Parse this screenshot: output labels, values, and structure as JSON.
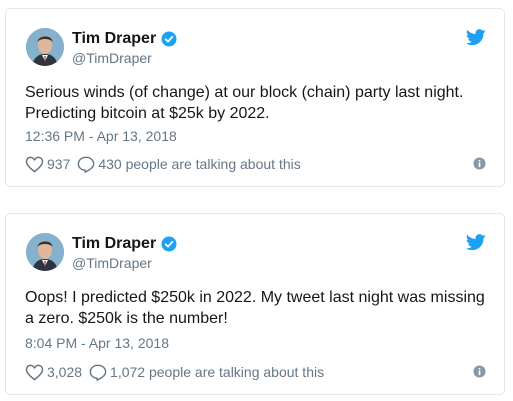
{
  "colors": {
    "accent": "#1da1f2",
    "text": "#14171a",
    "muted": "#657786",
    "border": "#e1e8ed"
  },
  "tweets": [
    {
      "author_name": "Tim Draper",
      "handle": "@TimDraper",
      "verified": true,
      "text": "Serious winds (of change) at our block (chain) party last night. Predicting bitcoin at $25k by 2022.",
      "timestamp": "12:36 PM - Apr 13, 2018",
      "likes": "937",
      "talking": "430 people are talking about this",
      "icons": [
        "twitter-bird-icon",
        "verified-badge-icon",
        "heart-icon",
        "comment-icon",
        "info-icon"
      ]
    },
    {
      "author_name": "Tim Draper",
      "handle": "@TimDraper",
      "verified": true,
      "text": "Oops! I predicted $250k in 2022. My tweet last night was missing a zero. $250k is the number!",
      "timestamp": "8:04 PM - Apr 13, 2018",
      "likes": "3,028",
      "talking": "1,072 people are talking about this",
      "icons": [
        "twitter-bird-icon",
        "verified-badge-icon",
        "heart-icon",
        "comment-icon",
        "info-icon"
      ]
    }
  ]
}
